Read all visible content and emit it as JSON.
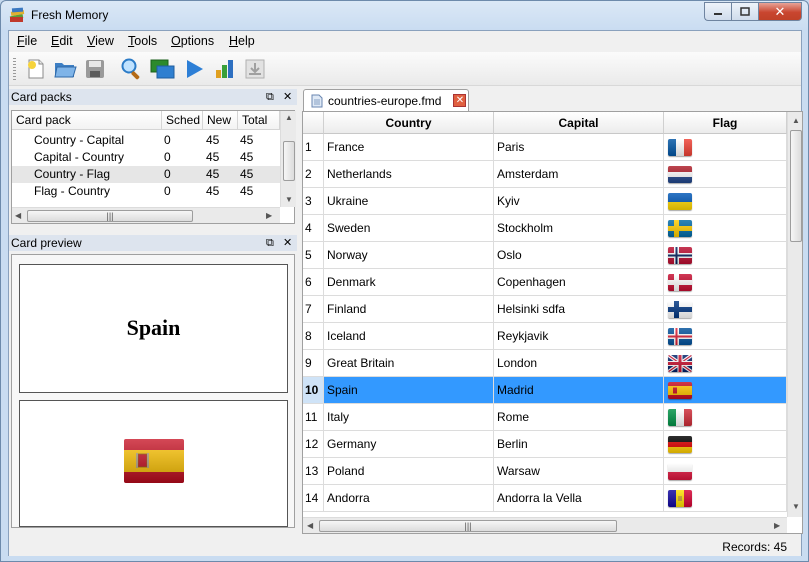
{
  "app": {
    "title": "Fresh Memory"
  },
  "menu": [
    {
      "label": "File",
      "u": "F",
      "rest": "ile"
    },
    {
      "label": "Edit",
      "u": "E",
      "rest": "dit"
    },
    {
      "label": "View",
      "u": "V",
      "rest": "iew"
    },
    {
      "label": "Tools",
      "u": "T",
      "rest": "ools"
    },
    {
      "label": "Options",
      "u": "O",
      "rest": "ptions"
    },
    {
      "label": "Help",
      "u": "H",
      "rest": "elp"
    }
  ],
  "toolbar": {
    "icons": [
      "new-file-icon",
      "open-folder-icon",
      "save-disk-icon",
      "search-magnifier-icon",
      "windows-icon",
      "play-icon",
      "statistics-chart-icon",
      "import-icon"
    ]
  },
  "card_packs": {
    "title": "Card packs",
    "headers": {
      "pack": "Card pack",
      "sched": "Sched",
      "new": "New",
      "total": "Total"
    },
    "rows": [
      {
        "pack": "Country - Capital",
        "sched": "0",
        "new": "45",
        "total": "45"
      },
      {
        "pack": "Capital - Country",
        "sched": "0",
        "new": "45",
        "total": "45"
      },
      {
        "pack": "Country - Flag",
        "sched": "0",
        "new": "45",
        "total": "45"
      },
      {
        "pack": "Flag - Country",
        "sched": "0",
        "new": "45",
        "total": "45"
      }
    ],
    "selected_index": 2
  },
  "card_preview": {
    "title": "Card preview",
    "question": "Spain",
    "answer_flag": "flag-spain-icon"
  },
  "document": {
    "tab_label": "countries-europe.fmd",
    "columns": {
      "country": "Country",
      "capital": "Capital",
      "flag": "Flag"
    },
    "rows": [
      {
        "num": "1",
        "country": "France",
        "capital": "Paris",
        "flag": "fr"
      },
      {
        "num": "2",
        "country": "Netherlands",
        "capital": "Amsterdam",
        "flag": "nl"
      },
      {
        "num": "3",
        "country": "Ukraine",
        "capital": "Kyiv",
        "flag": "ua"
      },
      {
        "num": "4",
        "country": "Sweden",
        "capital": "Stockholm",
        "flag": "se"
      },
      {
        "num": "5",
        "country": "Norway",
        "capital": "Oslo",
        "flag": "no"
      },
      {
        "num": "6",
        "country": "Denmark",
        "capital": "Copenhagen",
        "flag": "dk"
      },
      {
        "num": "7",
        "country": "Finland",
        "capital": "Helsinki sdfa",
        "flag": "fi"
      },
      {
        "num": "8",
        "country": "Iceland",
        "capital": "Reykjavik",
        "flag": "is"
      },
      {
        "num": "9",
        "country": "Great Britain",
        "capital": "London",
        "flag": "gb"
      },
      {
        "num": "10",
        "country": "Spain",
        "capital": "Madrid",
        "flag": "es"
      },
      {
        "num": "11",
        "country": "Italy",
        "capital": "Rome",
        "flag": "it"
      },
      {
        "num": "12",
        "country": "Germany",
        "capital": "Berlin",
        "flag": "de"
      },
      {
        "num": "13",
        "country": "Poland",
        "capital": "Warsaw",
        "flag": "pl"
      },
      {
        "num": "14",
        "country": "Andorra",
        "capital": "Andorra la Vella",
        "flag": "ad"
      }
    ],
    "selected_index": 9
  },
  "status": {
    "records": "Records: 45"
  },
  "colors": {
    "selection": "#3399ff",
    "row_number_selected": "#cfe3f7"
  }
}
